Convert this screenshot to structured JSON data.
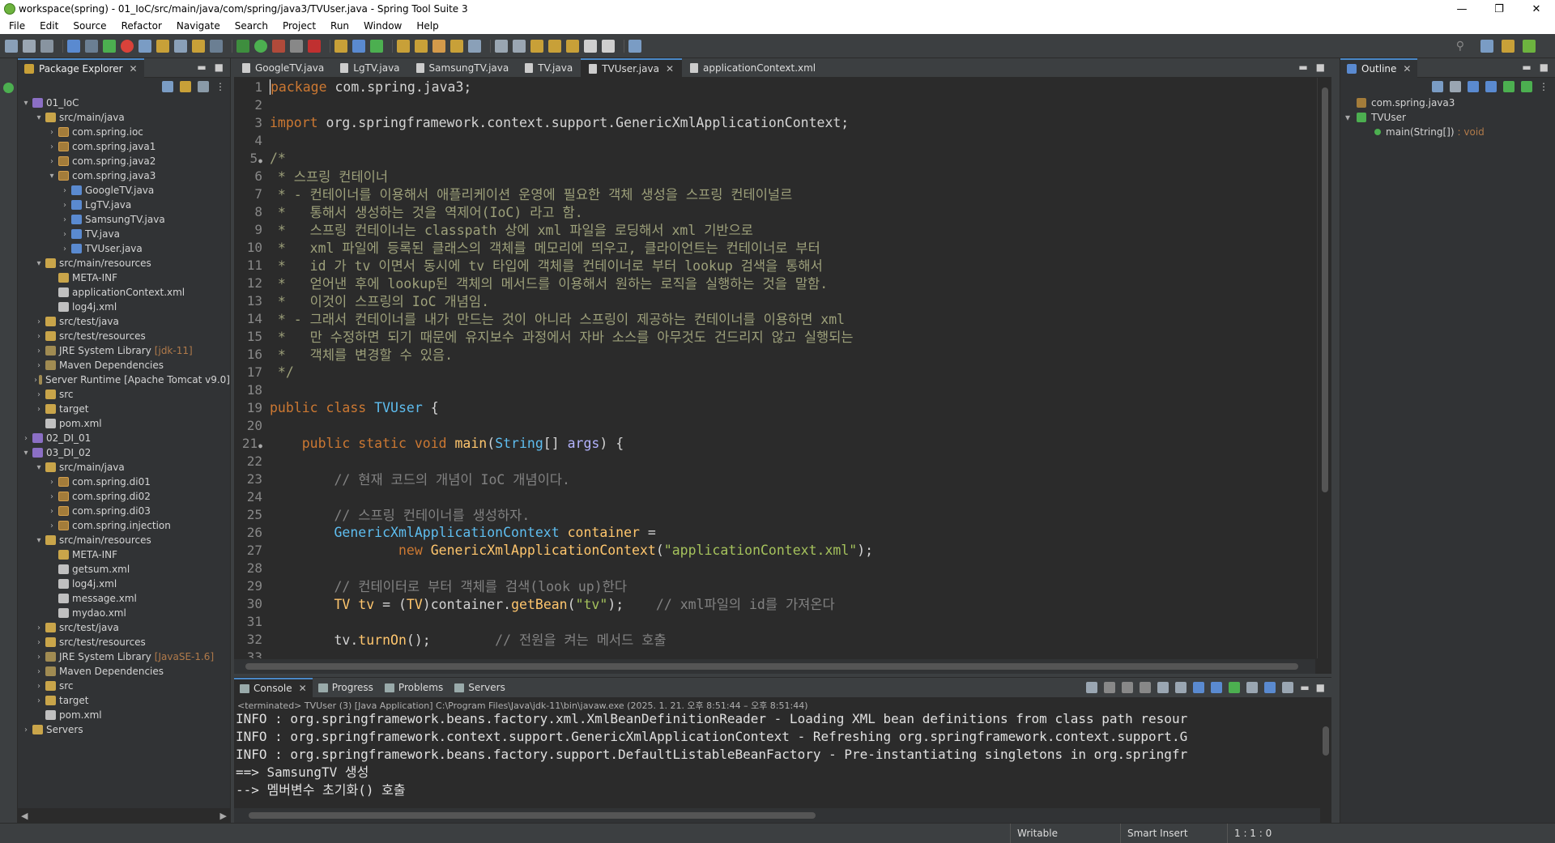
{
  "window": {
    "title": "workspace(spring) - 01_IoC/src/main/java/com/spring/java3/TVUser.java - Spring Tool Suite 3"
  },
  "menu": [
    "File",
    "Edit",
    "Source",
    "Refactor",
    "Navigate",
    "Search",
    "Project",
    "Run",
    "Window",
    "Help"
  ],
  "package_explorer": {
    "title": "Package Explorer",
    "tree": [
      {
        "depth": 0,
        "arrow": "▾",
        "icon": "proj",
        "label": "01_IoC"
      },
      {
        "depth": 1,
        "arrow": "▾",
        "icon": "folder",
        "label": "src/main/java"
      },
      {
        "depth": 2,
        "arrow": "›",
        "icon": "pkg",
        "label": "com.spring.ioc"
      },
      {
        "depth": 2,
        "arrow": "›",
        "icon": "pkg",
        "label": "com.spring.java1"
      },
      {
        "depth": 2,
        "arrow": "›",
        "icon": "pkg",
        "label": "com.spring.java2"
      },
      {
        "depth": 2,
        "arrow": "▾",
        "icon": "pkg",
        "label": "com.spring.java3"
      },
      {
        "depth": 3,
        "arrow": "›",
        "icon": "java",
        "label": "GoogleTV.java"
      },
      {
        "depth": 3,
        "arrow": "›",
        "icon": "java",
        "label": "LgTV.java"
      },
      {
        "depth": 3,
        "arrow": "›",
        "icon": "java",
        "label": "SamsungTV.java"
      },
      {
        "depth": 3,
        "arrow": "›",
        "icon": "java",
        "label": "TV.java"
      },
      {
        "depth": 3,
        "arrow": "›",
        "icon": "java",
        "label": "TVUser.java"
      },
      {
        "depth": 1,
        "arrow": "▾",
        "icon": "folder",
        "label": "src/main/resources"
      },
      {
        "depth": 2,
        "arrow": "",
        "icon": "folder",
        "label": "META-INF"
      },
      {
        "depth": 2,
        "arrow": "",
        "icon": "xml",
        "label": "applicationContext.xml"
      },
      {
        "depth": 2,
        "arrow": "",
        "icon": "xml",
        "label": "log4j.xml"
      },
      {
        "depth": 1,
        "arrow": "›",
        "icon": "folder",
        "label": "src/test/java"
      },
      {
        "depth": 1,
        "arrow": "›",
        "icon": "folder",
        "label": "src/test/resources"
      },
      {
        "depth": 1,
        "arrow": "›",
        "icon": "lib",
        "label": "JRE System Library",
        "suffix": "[jdk-11]"
      },
      {
        "depth": 1,
        "arrow": "›",
        "icon": "lib",
        "label": "Maven Dependencies"
      },
      {
        "depth": 1,
        "arrow": "›",
        "icon": "lib",
        "label": "Server Runtime [Apache Tomcat v9.0]"
      },
      {
        "depth": 1,
        "arrow": "›",
        "icon": "folder",
        "label": "src"
      },
      {
        "depth": 1,
        "arrow": "›",
        "icon": "folder",
        "label": "target"
      },
      {
        "depth": 1,
        "arrow": "",
        "icon": "xml",
        "label": "pom.xml"
      },
      {
        "depth": 0,
        "arrow": "›",
        "icon": "proj",
        "label": "02_DI_01"
      },
      {
        "depth": 0,
        "arrow": "▾",
        "icon": "proj",
        "label": "03_DI_02"
      },
      {
        "depth": 1,
        "arrow": "▾",
        "icon": "folder",
        "label": "src/main/java"
      },
      {
        "depth": 2,
        "arrow": "›",
        "icon": "pkg",
        "label": "com.spring.di01"
      },
      {
        "depth": 2,
        "arrow": "›",
        "icon": "pkg",
        "label": "com.spring.di02"
      },
      {
        "depth": 2,
        "arrow": "›",
        "icon": "pkg",
        "label": "com.spring.di03"
      },
      {
        "depth": 2,
        "arrow": "›",
        "icon": "pkg",
        "label": "com.spring.injection"
      },
      {
        "depth": 1,
        "arrow": "▾",
        "icon": "folder",
        "label": "src/main/resources"
      },
      {
        "depth": 2,
        "arrow": "",
        "icon": "folder",
        "label": "META-INF"
      },
      {
        "depth": 2,
        "arrow": "",
        "icon": "xml",
        "label": "getsum.xml"
      },
      {
        "depth": 2,
        "arrow": "",
        "icon": "xml",
        "label": "log4j.xml"
      },
      {
        "depth": 2,
        "arrow": "",
        "icon": "xml",
        "label": "message.xml"
      },
      {
        "depth": 2,
        "arrow": "",
        "icon": "xml",
        "label": "mydao.xml"
      },
      {
        "depth": 1,
        "arrow": "›",
        "icon": "folder",
        "label": "src/test/java"
      },
      {
        "depth": 1,
        "arrow": "›",
        "icon": "folder",
        "label": "src/test/resources"
      },
      {
        "depth": 1,
        "arrow": "›",
        "icon": "lib",
        "label": "JRE System Library",
        "suffix": "[JavaSE-1.6]"
      },
      {
        "depth": 1,
        "arrow": "›",
        "icon": "lib",
        "label": "Maven Dependencies"
      },
      {
        "depth": 1,
        "arrow": "›",
        "icon": "folder",
        "label": "src"
      },
      {
        "depth": 1,
        "arrow": "›",
        "icon": "folder",
        "label": "target"
      },
      {
        "depth": 1,
        "arrow": "",
        "icon": "xml",
        "label": "pom.xml"
      },
      {
        "depth": 0,
        "arrow": "›",
        "icon": "folder",
        "label": "Servers"
      }
    ]
  },
  "editor": {
    "tabs": [
      {
        "label": "GoogleTV.java",
        "active": false
      },
      {
        "label": "LgTV.java",
        "active": false
      },
      {
        "label": "SamsungTV.java",
        "active": false
      },
      {
        "label": "TV.java",
        "active": false
      },
      {
        "label": "TVUser.java",
        "active": true
      },
      {
        "label": "applicationContext.xml",
        "active": false
      }
    ],
    "lines": [
      {
        "n": "1",
        "html": "<span class='cursor'></span><span class='kw'>package</span> com.spring.java3;"
      },
      {
        "n": "2",
        "html": ""
      },
      {
        "n": "3",
        "html": "<span class='kw'>import</span> org.springframework.context.support.GenericXmlApplicationContext;"
      },
      {
        "n": "4",
        "html": ""
      },
      {
        "n": "5",
        "fold": true,
        "html": "<span class='cm'>/*</span>"
      },
      {
        "n": "6",
        "html": "<span class='cm'> * 스프링 컨테이너</span>"
      },
      {
        "n": "7",
        "html": "<span class='cm'> * - 컨테이너를 이용해서 애플리케이션 운영에 필요한 객체 생성을 스프링 컨테이널르</span>"
      },
      {
        "n": "8",
        "html": "<span class='cm'> *   통해서 생성하는 것을 역제어(IoC) 라고 함.</span>"
      },
      {
        "n": "9",
        "html": "<span class='cm'> *   스프링 컨테이너는 classpath 상에 xml 파일을 로딩해서 xml 기반으로</span>"
      },
      {
        "n": "10",
        "html": "<span class='cm'> *   xml 파일에 등록된 클래스의 객체를 메모리에 띄우고, 클라이언트는 컨테이너로 부터</span>"
      },
      {
        "n": "11",
        "html": "<span class='cm'> *   id 가 tv 이면서 동시에 tv 타입에 객체를 컨테이너로 부터 lookup 검색을 통해서</span>"
      },
      {
        "n": "12",
        "html": "<span class='cm'> *   얻어낸 후에 lookup된 객체의 메서드를 이용해서 원하는 로직을 실행하는 것을 말함.</span>"
      },
      {
        "n": "13",
        "html": "<span class='cm'> *   이것이 스프링의 IoC 개념임.</span>"
      },
      {
        "n": "14",
        "html": "<span class='cm'> * - 그래서 컨테이너를 내가 만드는 것이 아니라 스프링이 제공하는 컨테이너를 이용하면 xml</span>"
      },
      {
        "n": "15",
        "html": "<span class='cm'> *   만 수정하면 되기 때문에 유지보수 과정에서 자바 소스를 아무것도 건드리지 않고 실행되는</span>"
      },
      {
        "n": "16",
        "html": "<span class='cm'> *   객체를 변경할 수 있음.</span>"
      },
      {
        "n": "17",
        "html": "<span class='cm'> */</span>"
      },
      {
        "n": "18",
        "html": ""
      },
      {
        "n": "19",
        "html": "<span class='kw'>public class</span> <span class='typ2'>TVUser</span> {"
      },
      {
        "n": "20",
        "html": ""
      },
      {
        "n": "21",
        "fold": true,
        "html": "    <span class='kw'>public static void</span> <span class='meth'>main</span>(<span class='typ2'>String</span>[] <span class='args'>args</span>) {"
      },
      {
        "n": "22",
        "html": ""
      },
      {
        "n": "23",
        "html": "        <span class='slashcm'>// 현재 코드의 개념이 IoC 개념이다.</span>"
      },
      {
        "n": "24",
        "html": ""
      },
      {
        "n": "25",
        "html": "        <span class='slashcm'>// 스프링 컨테이너를 생성하자.</span>"
      },
      {
        "n": "26",
        "html": "        <span class='typ2'>GenericXmlApplicationContext</span> <span class='cls'>container</span> ="
      },
      {
        "n": "27",
        "html": "                <span class='kw'>new</span> <span class='meth'>GenericXmlApplicationContext</span>(<span class='strg'>\"applicationContext.xml\"</span>);"
      },
      {
        "n": "28",
        "html": ""
      },
      {
        "n": "29",
        "html": "        <span class='slashcm'>// 컨테이터로 부터 객체를 검색(look up)한다</span>"
      },
      {
        "n": "30",
        "html": "        <span class='cls'>TV</span> <span class='cls'>tv</span> = (<span class='cls'>TV</span>)container.<span class='meth'>getBean</span>(<span class='strg'>\"tv\"</span>);    <span class='slashcm'>// xml파일의 id를 가져온다</span>"
      },
      {
        "n": "31",
        "html": ""
      },
      {
        "n": "32",
        "html": "        tv.<span class='meth'>turnOn</span>();        <span class='slashcm'>// 전원을 켜는 메서드 호출</span>"
      },
      {
        "n": "33",
        "html": ""
      }
    ]
  },
  "outline": {
    "title": "Outline",
    "items": [
      {
        "depth": 0,
        "arrow": "",
        "icon": "pkg",
        "label": "com.spring.java3"
      },
      {
        "depth": 0,
        "arrow": "▾",
        "icon": "java",
        "label": "TVUser"
      },
      {
        "depth": 1,
        "arrow": "",
        "icon": "meth",
        "label": "main(String[])",
        "ret": ": void"
      }
    ]
  },
  "console": {
    "tabs": [
      {
        "label": "Console",
        "active": true
      },
      {
        "label": "Progress",
        "active": false
      },
      {
        "label": "Problems",
        "active": false
      },
      {
        "label": "Servers",
        "active": false
      }
    ],
    "terminated": "<terminated> TVUser (3) [Java Application] C:\\Program Files\\Java\\jdk-11\\bin\\javaw.exe  (2025. 1. 21. 오후 8:51:44 – 오후 8:51:44)",
    "lines": [
      "INFO : org.springframework.beans.factory.xml.XmlBeanDefinitionReader - Loading XML bean definitions from class path resour",
      "INFO : org.springframework.context.support.GenericXmlApplicationContext - Refreshing org.springframework.context.support.G",
      "INFO : org.springframework.beans.factory.support.DefaultListableBeanFactory - Pre-instantiating singletons in org.springfr",
      "==> SamsungTV 생성",
      "--> 멤버변수 초기화() 호출"
    ]
  },
  "status": {
    "writable": "Writable",
    "insert": "Smart Insert",
    "position": "1 : 1 : 0"
  }
}
